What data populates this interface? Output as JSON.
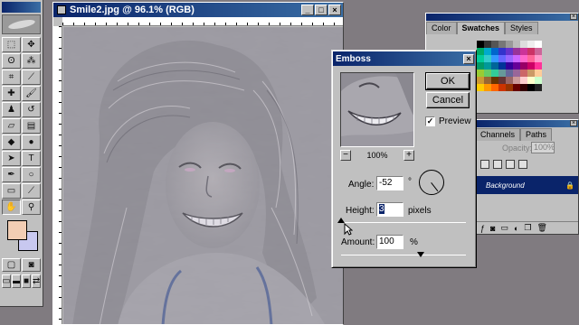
{
  "document": {
    "title": "Smile2.jpg @ 96.1% (RGB)",
    "min_glyph": "_",
    "max_glyph": "□",
    "close_glyph": "×"
  },
  "toolbox": {
    "tools": [
      {
        "icon": "marquee-icon",
        "glyph": "⬚"
      },
      {
        "icon": "move-icon",
        "glyph": "✥"
      },
      {
        "icon": "lasso-icon",
        "glyph": "ʘ"
      },
      {
        "icon": "magic-wand-icon",
        "glyph": "⁂"
      },
      {
        "icon": "crop-icon",
        "glyph": "⌗"
      },
      {
        "icon": "slice-icon",
        "glyph": "⟋"
      },
      {
        "icon": "healing-brush-icon",
        "glyph": "✚"
      },
      {
        "icon": "brush-icon",
        "glyph": "🖌"
      },
      {
        "icon": "clone-stamp-icon",
        "glyph": "♟"
      },
      {
        "icon": "history-brush-icon",
        "glyph": "↺"
      },
      {
        "icon": "eraser-icon",
        "glyph": "▱"
      },
      {
        "icon": "gradient-icon",
        "glyph": "▤"
      },
      {
        "icon": "blur-icon",
        "glyph": "◆"
      },
      {
        "icon": "dodge-icon",
        "glyph": "●"
      },
      {
        "icon": "path-selection-icon",
        "glyph": "➤"
      },
      {
        "icon": "type-icon",
        "glyph": "T"
      },
      {
        "icon": "pen-icon",
        "glyph": "✒"
      },
      {
        "icon": "shape-icon",
        "glyph": "○"
      },
      {
        "icon": "notes-icon",
        "glyph": "▭"
      },
      {
        "icon": "eyedropper-icon",
        "glyph": "⟋"
      },
      {
        "icon": "hand-icon",
        "glyph": "✋"
      },
      {
        "icon": "zoom-icon",
        "glyph": "⚲"
      }
    ],
    "selected_tool_index": 20,
    "mode_buttons": [
      {
        "icon": "standard-mode-icon",
        "glyph": "▢"
      },
      {
        "icon": "quickmask-mode-icon",
        "glyph": "◙"
      },
      {
        "icon": "screen-mode-standard-icon",
        "glyph": "▭"
      },
      {
        "icon": "screen-mode-full-icon",
        "glyph": "▬"
      },
      {
        "icon": "screen-mode-fullscreen-icon",
        "glyph": "■"
      },
      {
        "icon": "jump-to-imageready-icon",
        "glyph": "⇄"
      }
    ],
    "foreground_color": "#f2cdb4",
    "background_color": "#c8c8f0"
  },
  "swatches_palette": {
    "tabs": [
      "Color",
      "Swatches",
      "Styles"
    ],
    "active_tab": "Swatches",
    "colors": [
      "#000000",
      "#333333",
      "#555555",
      "#777777",
      "#999999",
      "#bbbbbb",
      "#dddddd",
      "#eeeeee",
      "#ffffff",
      "#00aa66",
      "#00aacc",
      "#0066cc",
      "#3333cc",
      "#6633cc",
      "#993399",
      "#cc3399",
      "#cc3366",
      "#cc6699",
      "#00cc99",
      "#33cccc",
      "#3399ff",
      "#6666ff",
      "#9966ff",
      "#cc66ff",
      "#ff66cc",
      "#ff6699",
      "#ff99cc",
      "#009966",
      "#009999",
      "#006699",
      "#003399",
      "#330099",
      "#660099",
      "#990066",
      "#cc0066",
      "#ff3399",
      "#99cc33",
      "#66cc66",
      "#33cc99",
      "#669999",
      "#666699",
      "#996699",
      "#cc6666",
      "#cc9966",
      "#ffcc99",
      "#cc9933",
      "#996633",
      "#663300",
      "#663333",
      "#996666",
      "#cc9999",
      "#ffcccc",
      "#ffffcc",
      "#ccffcc",
      "#ffcc00",
      "#ff9900",
      "#ff6600",
      "#cc3300",
      "#993300",
      "#660000",
      "#330000",
      "#000000",
      "#222222"
    ]
  },
  "layers_palette": {
    "tabs": [
      "Channels",
      "Paths"
    ],
    "opacity_label": "Opacity:",
    "opacity_value": "100%",
    "layer_name": "Background"
  },
  "emboss_dialog": {
    "title": "Emboss",
    "ok_label": "OK",
    "cancel_label": "Cancel",
    "preview_label": "Preview",
    "preview_checked": true,
    "zoom_minus": "−",
    "zoom_plus": "+",
    "zoom_value": "100%",
    "angle_label": "Angle:",
    "angle_value": "-52",
    "angle_unit": "°",
    "height_label": "Height:",
    "height_value": "3",
    "height_unit": "pixels",
    "amount_label": "Amount:",
    "amount_value": "100",
    "amount_unit": "%",
    "height_slider_fraction": 0.0,
    "amount_slider_fraction": 0.2
  }
}
